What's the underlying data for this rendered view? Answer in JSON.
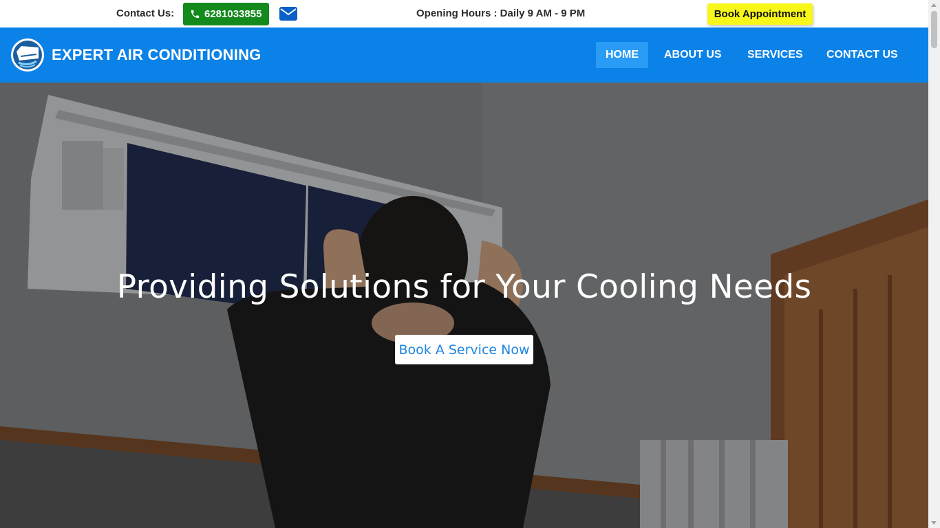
{
  "topbar": {
    "contact_label": "Contact Us:",
    "phone": "6281033855",
    "phone_icon": "phone-icon",
    "mail_icon": "envelope-icon",
    "hours": "Opening Hours : Daily 9 AM - 9 PM",
    "book_label": "Book Appointment",
    "colors": {
      "phone_bg": "#148a1c",
      "book_bg": "#f7f71a",
      "mail": "#0a5fc9"
    }
  },
  "navbar": {
    "brand": "EXPERT AIR CONDITIONING",
    "logo_icon": "air-conditioner-logo-icon",
    "items": [
      {
        "label": "HOME",
        "active": true
      },
      {
        "label": "ABOUT US",
        "active": false
      },
      {
        "label": "SERVICES",
        "active": false
      },
      {
        "label": "CONTACT US",
        "active": false
      }
    ],
    "colors": {
      "bg": "#0a82e8",
      "active_bg": "#2a9cf5"
    }
  },
  "hero": {
    "title": "Providing Solutions for Your Cooling Needs",
    "cta_label": "Book A Service Now",
    "background": "technician-servicing-wall-air-conditioner-photo",
    "colors": {
      "cta_text": "#1c86e0"
    }
  }
}
